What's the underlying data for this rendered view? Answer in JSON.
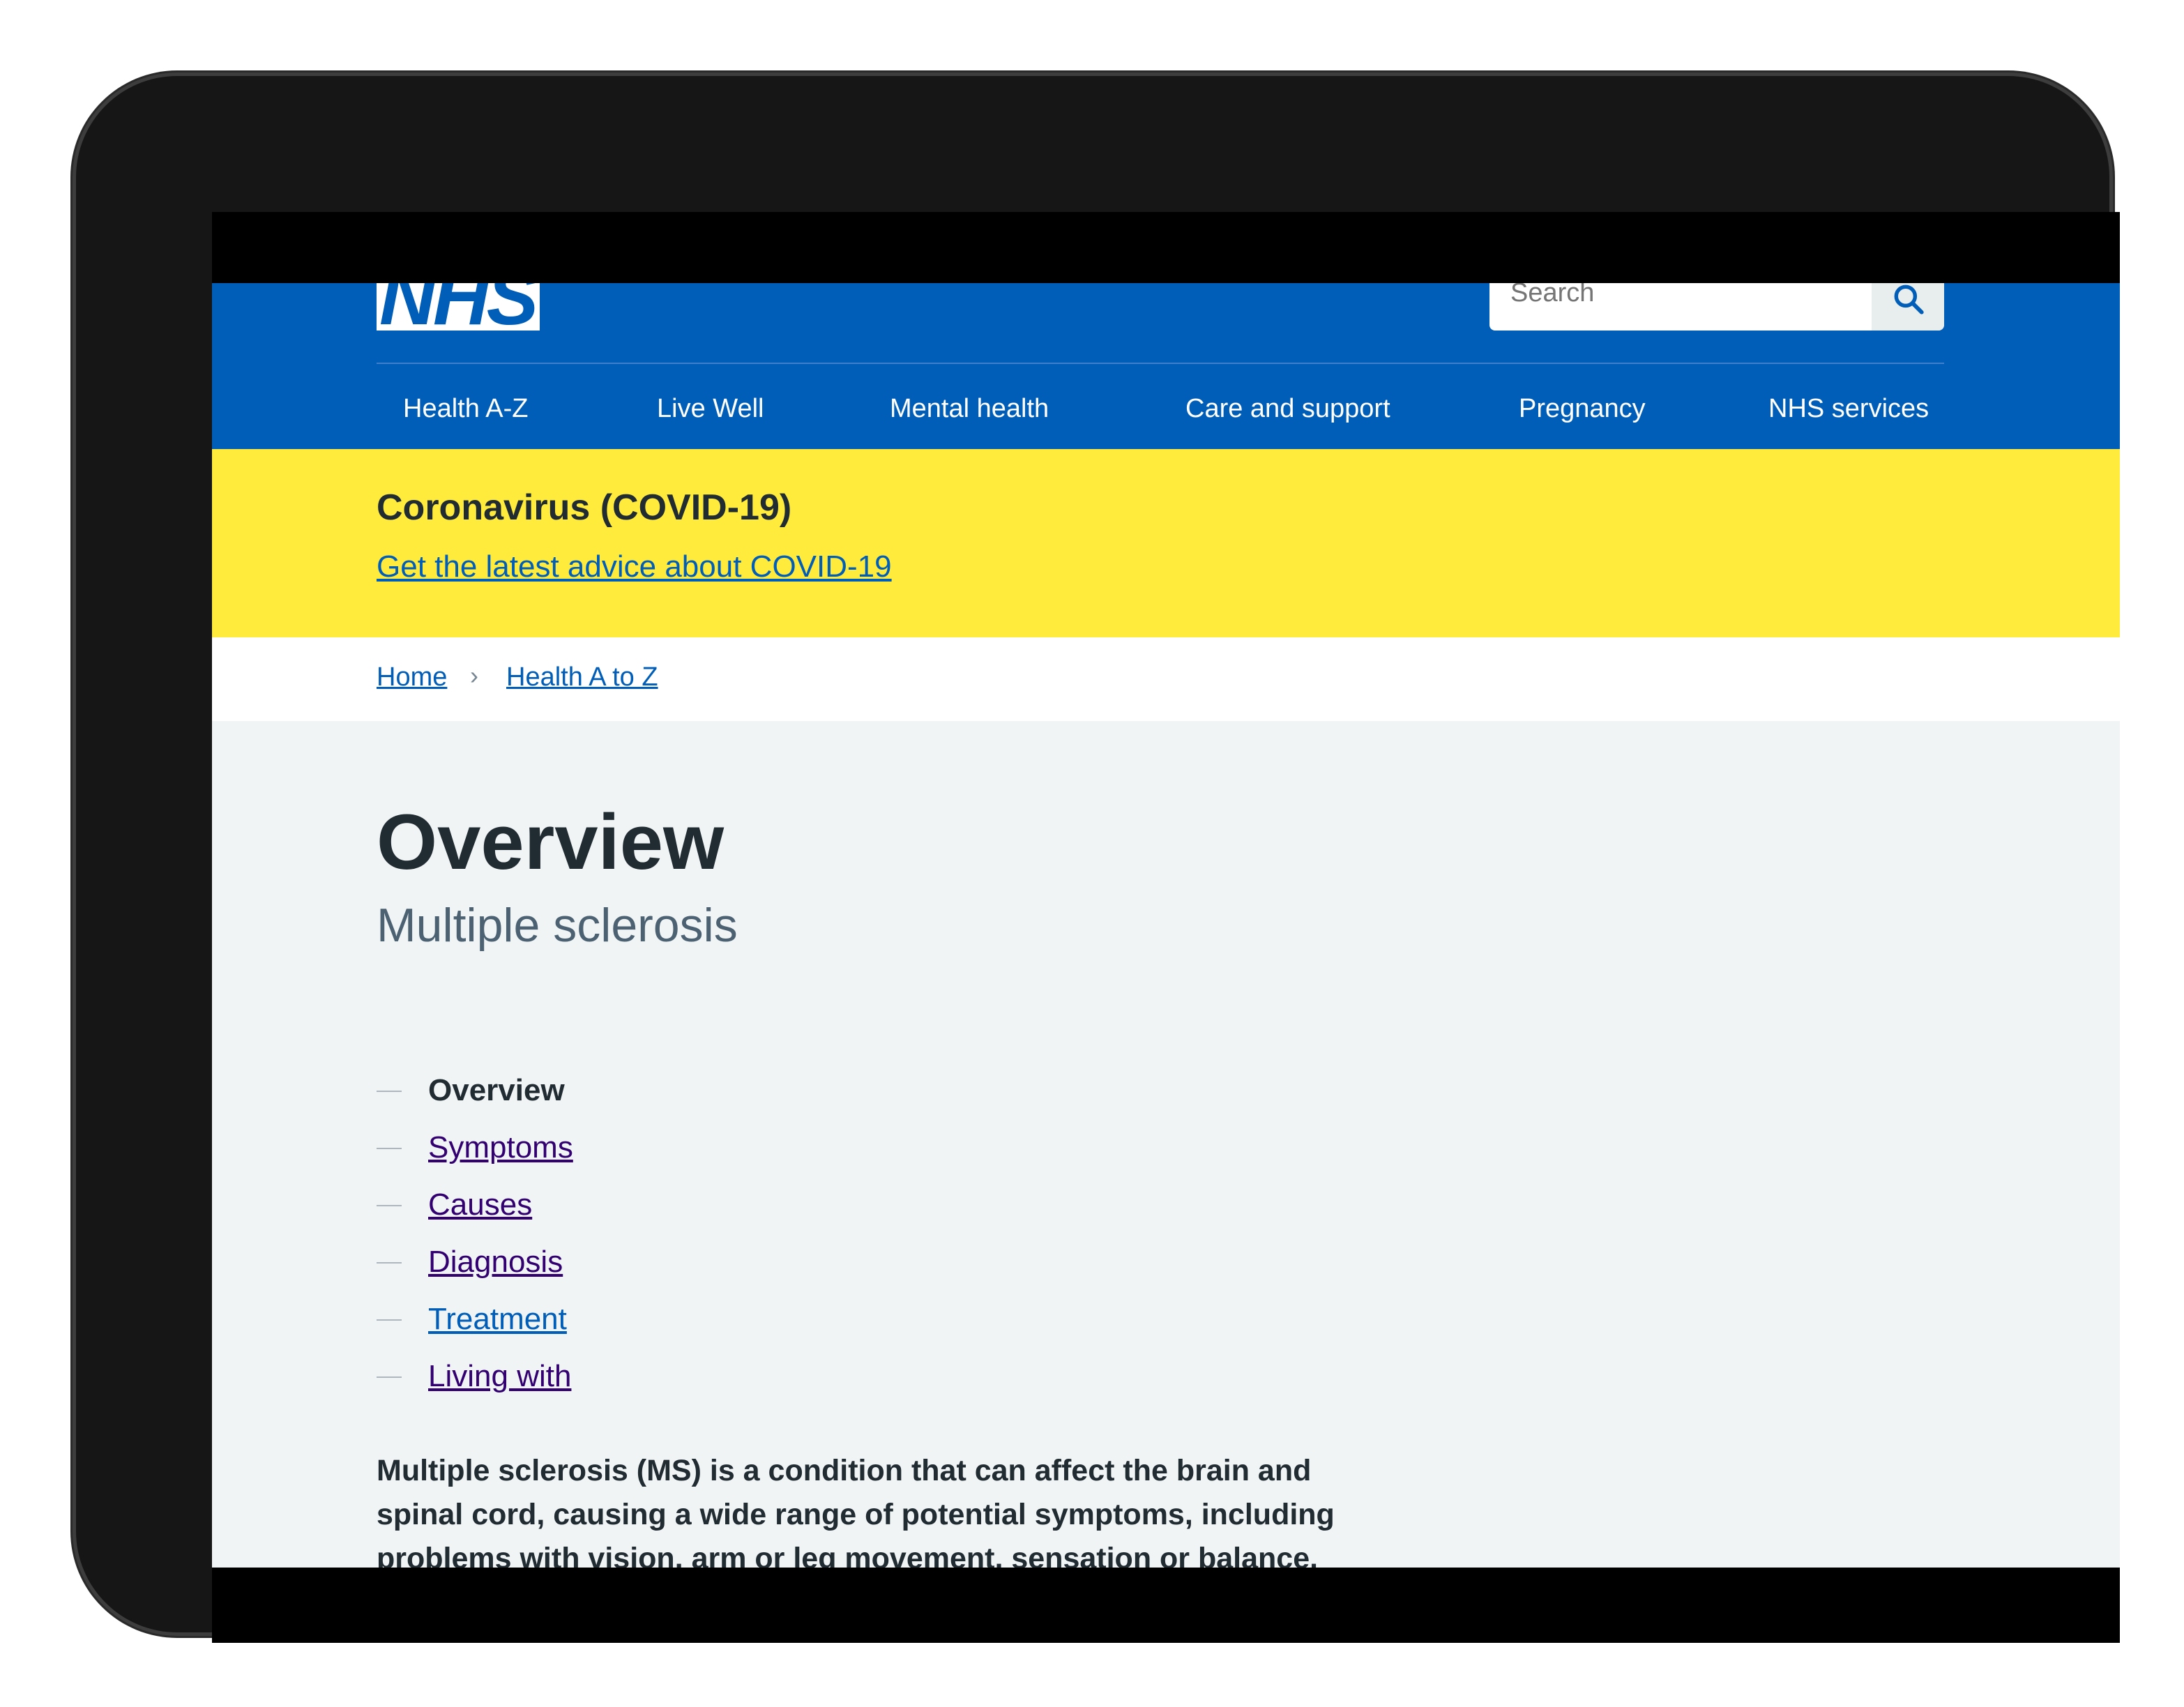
{
  "header": {
    "logo_text": "NHS",
    "search_placeholder": "Search",
    "nav": [
      "Health A-Z",
      "Live Well",
      "Mental health",
      "Care and support",
      "Pregnancy",
      "NHS services"
    ]
  },
  "alert": {
    "title": "Coronavirus (COVID-19)",
    "link": "Get the latest advice about COVID-19"
  },
  "breadcrumb": [
    "Home",
    "Health A to Z"
  ],
  "page": {
    "title": "Overview",
    "caption": "Multiple sclerosis",
    "contents": [
      {
        "label": "Overview",
        "current": true
      },
      {
        "label": "Symptoms",
        "current": false
      },
      {
        "label": "Causes",
        "current": false
      },
      {
        "label": "Diagnosis",
        "current": false
      },
      {
        "label": "Treatment",
        "current": false
      },
      {
        "label": "Living with",
        "current": false
      }
    ],
    "lede": "Multiple sclerosis (MS) is a condition that can affect the brain and spinal cord, causing a wide range of potential symptoms, including problems with vision, arm or leg movement, sensation or balance."
  },
  "colors": {
    "nhs_blue": "#005eb8",
    "alert_yellow": "#ffeb3b",
    "page_bg": "#f0f4f5",
    "visited_link": "#330072",
    "text": "#212b32",
    "device_frame": "#161616"
  },
  "icons": {
    "search": "search-icon",
    "breadcrumb_separator": "chevron-right-icon"
  }
}
